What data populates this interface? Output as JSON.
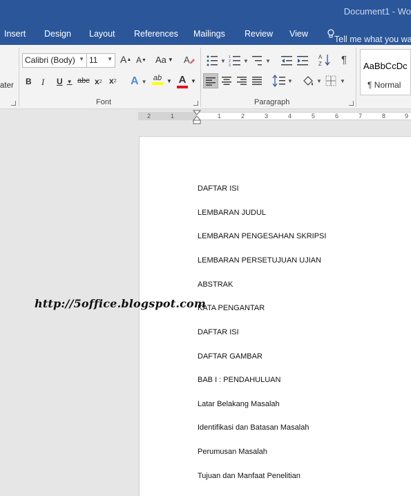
{
  "window": {
    "title": "Document1 - Wo"
  },
  "menu": {
    "tabs": [
      "Insert",
      "Design",
      "Layout",
      "References",
      "Mailings",
      "Review",
      "View"
    ],
    "tell_me": "Tell me what you wa"
  },
  "ribbon": {
    "clipboard_fragment": "ater",
    "font": {
      "family": "Calibri (Body)",
      "size": "11",
      "group_label": "Font",
      "grow": "A",
      "shrink": "A",
      "change_case": "Aa",
      "bold": "B",
      "italic": "I",
      "underline": "U",
      "strike": "abc",
      "subscript": "x",
      "superscript": "x",
      "effects": "A",
      "highlight": "ab",
      "color": "A"
    },
    "paragraph": {
      "group_label": "Paragraph",
      "show_marks": "¶"
    },
    "styles": {
      "sample": "AaBbCcDc",
      "name": "¶ Normal"
    }
  },
  "ruler": {
    "numbers": [
      "2",
      "1",
      "1",
      "2",
      "3",
      "4",
      "5",
      "6",
      "7",
      "8",
      "9"
    ]
  },
  "document": {
    "lines": [
      "DAFTAR ISI",
      "LEMBARAN JUDUL",
      "LEMBARAN PENGESAHAN SKRIPSI",
      "LEMBARAN PERSETUJUAN UJIAN",
      "ABSTRAK",
      "KATA PENGANTAR",
      "DAFTAR ISI",
      "DAFTAR GAMBAR",
      "BAB I : PENDAHULUAN",
      "Latar Belakang Masalah",
      "Identifikasi dan Batasan Masalah",
      "Perumusan Masalah",
      "Tujuan dan Manfaat Penelitian"
    ]
  },
  "watermark": "http://5office.blogspot.com",
  "colors": {
    "brand": "#2b579a",
    "highlight": "#ffff00",
    "font_color": "#e81123"
  }
}
